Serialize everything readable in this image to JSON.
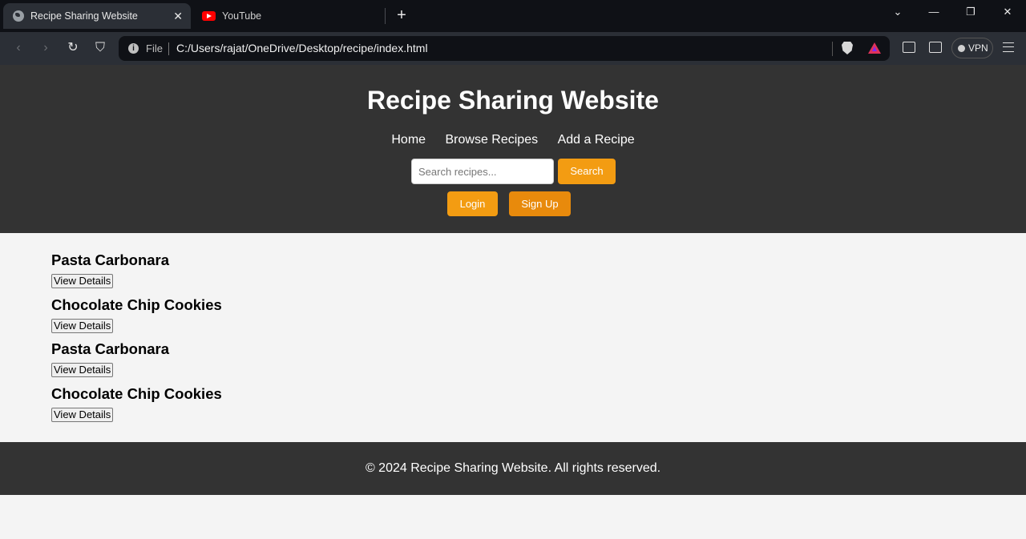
{
  "browser": {
    "tabs": [
      {
        "title": "Recipe Sharing Website",
        "active": true,
        "icon": "globe-icon"
      },
      {
        "title": "YouTube",
        "active": false,
        "icon": "youtube-icon"
      }
    ],
    "new_tab": "+",
    "window_controls": {
      "tab_search": "⌄",
      "minimize": "—",
      "restore": "❐",
      "close": "✕"
    },
    "address": {
      "scheme_label": "File",
      "url": "C:/Users/rajat/OneDrive/Desktop/recipe/index.html"
    },
    "vpn_label": "VPN",
    "colors": {
      "tabbar": "#0f1116",
      "toolbar": "#2b2f36"
    }
  },
  "site": {
    "title": "Recipe Sharing Website",
    "nav": [
      "Home",
      "Browse Recipes",
      "Add a Recipe"
    ],
    "search": {
      "placeholder": "Search recipes...",
      "button": "Search"
    },
    "auth": {
      "login": "Login",
      "signup": "Sign Up"
    },
    "recipes": [
      {
        "name": "Pasta Carbonara",
        "button": "View Details"
      },
      {
        "name": "Chocolate Chip Cookies",
        "button": "View Details"
      },
      {
        "name": "Pasta Carbonara",
        "button": "View Details"
      },
      {
        "name": "Chocolate Chip Cookies",
        "button": "View Details"
      }
    ],
    "footer": "© 2024 Recipe Sharing Website. All rights reserved.",
    "colors": {
      "header": "#333333",
      "accent": "#f39c12",
      "background": "#f4f4f4"
    }
  }
}
